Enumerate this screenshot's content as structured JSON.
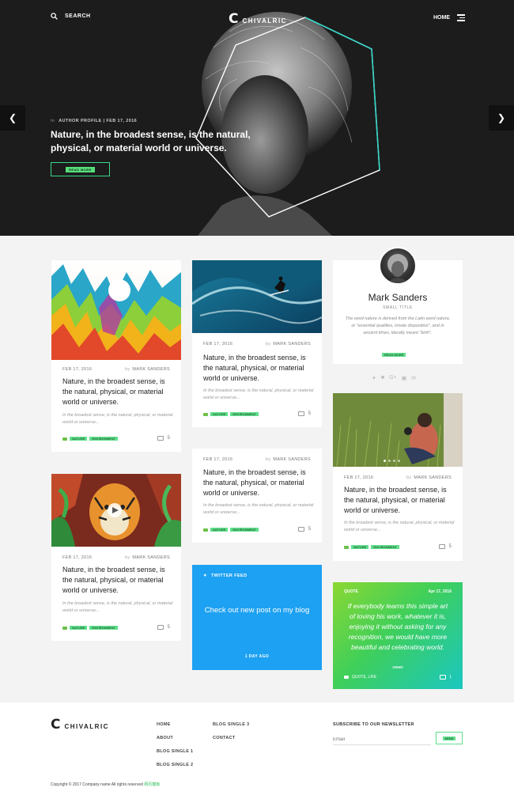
{
  "header": {
    "search_label": "SEARCH",
    "logo_mark": "C",
    "logo_name": "CHIVALRIC",
    "nav_label": "HOME"
  },
  "hero": {
    "meta_prefix": "in",
    "meta": "AUTHOR PROFILE | FEB 17, 2016",
    "title": "Nature, in the broadest sense, is the natural, physical, or material world or universe.",
    "button_label": "READ MORE"
  },
  "posts": [
    {
      "date": "FEB 17, 2016",
      "by": "by",
      "author": "MARK SANDERS",
      "title": "Nature, in the broadest sense, is the natural, physical, or material world or universe.",
      "excerpt": "In the broadest sense, is the natural, physical, or material world or universe...",
      "tags": [
        "NATURE",
        "ENVIRONMENT"
      ],
      "comments": "5"
    },
    {
      "date": "FEB 17, 2016",
      "by": "by",
      "author": "MARK SANDERS",
      "title": "Nature, in the broadest sense, is the natural, physical, or material world or universe.",
      "excerpt": "In the broadest sense, is the natural, physical, or material world or universe...",
      "tags": [
        "NATURE",
        "ENVIRONMENT"
      ],
      "comments": "5"
    },
    {
      "date": "FEB 17, 2016",
      "by": "by",
      "author": "MARK SANDERS",
      "title": "Nature, in the broadest sense, is the natural, physical, or material world or universe.",
      "excerpt": "In the broadest sense, is the natural, physical, or material world or universe...",
      "tags": [
        "NATURE",
        "ENVIRONMENT"
      ],
      "comments": "5"
    },
    {
      "date": "FEB 17, 2016",
      "by": "by",
      "author": "MARK SANDERS",
      "title": "Nature, in the broadest sense, is the natural, physical, or material world or universe.",
      "excerpt": "In the broadest sense, is the natural, physical, or material world or universe...",
      "tags": [
        "NATURE",
        "ENVIRONMENT"
      ],
      "comments": "5"
    },
    {
      "date": "FEB 17, 2016",
      "by": "by",
      "author": "MARK SANDERS",
      "title": "Nature, in the broadest sense, is the natural, physical, or material world or universe.",
      "excerpt": "In the broadest sense, is the natural, physical, or material world or universe...",
      "tags": [
        "NATURE",
        "ENVIRONMENT"
      ],
      "comments": "5"
    }
  ],
  "profile": {
    "name": "Mark Sanders",
    "role": "SMALL TITLE",
    "bio": "The word nature is derived from the Latin word natura, or \"essential qualities, innate disposition\", and in ancient times, literally meant \"birth\".",
    "button_label": "READ MORE"
  },
  "twitter": {
    "heading": "TWITTER FEED",
    "text": "Check out new post on my blog",
    "time": "1 DAY AGO"
  },
  "quote": {
    "left_label": "QUOTE",
    "right_label": "Apr 17, 2016",
    "text": "If everybody learns this simple art of loving his work, whatever it is, enjoying it without asking for any recognition, we would have more beautiful and celebrating world.",
    "author": "OSHO",
    "category": "QUOTE, LIFE",
    "comments": "1"
  },
  "footer": {
    "logo_mark": "C",
    "logo_name": "CHIVALRIC",
    "col1": [
      "HOME",
      "ABOUT",
      "BLOG SINGLE 1",
      "BLOG SINGLE 2"
    ],
    "col2": [
      "BLOG SINGLE 3",
      "CONTACT"
    ],
    "newsletter_title": "SUBSCRIBE TO OUR NEWSLETTER",
    "email_placeholder": "Email",
    "newsletter_button": "SEND",
    "copyright": "Copyright © 2017 Company name All rights reserved",
    "copyright_link": "网页模板"
  },
  "colors": {
    "accent": "#5fe08c",
    "twitter": "#1da1f2",
    "hero_bg": "#1c1c1c"
  }
}
